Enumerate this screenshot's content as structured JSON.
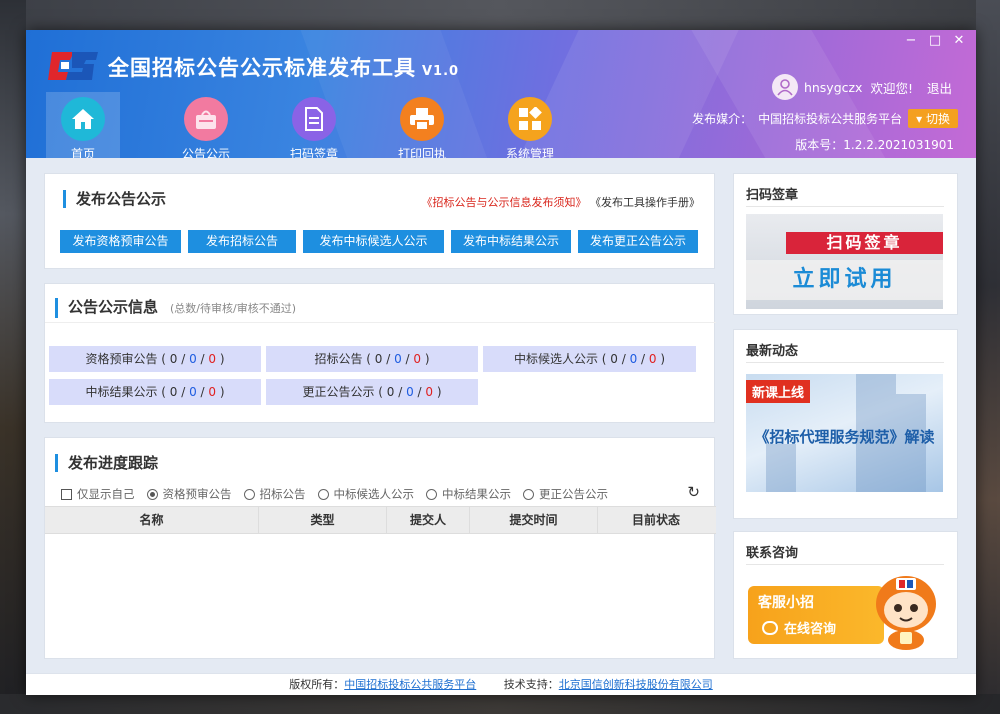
{
  "window": {
    "title": "全国招标公告公示标准发布工具",
    "version_badge": "V1.0",
    "minimize": "−",
    "maximize": "□",
    "close": "✕"
  },
  "nav": [
    {
      "label": "首页",
      "icon": "home-icon",
      "color": "#1fb8d8"
    },
    {
      "label": "公告公示",
      "icon": "bag-icon",
      "color": "#f27aa0"
    },
    {
      "label": "扫码签章",
      "icon": "document-icon",
      "color": "#8a63e6"
    },
    {
      "label": "打印回执",
      "icon": "printer-icon",
      "color": "#f3801f"
    },
    {
      "label": "系统管理",
      "icon": "grid-icon",
      "color": "#f5a31d"
    }
  ],
  "user": {
    "name": "hnsygczx",
    "welcome": "欢迎您!",
    "logout": "退出"
  },
  "media": {
    "label": "发布媒介：",
    "value": "中国招标投标公共服务平台",
    "switch": "▾ 切换"
  },
  "version": {
    "label": "版本号：",
    "value": "1.2.2.2021031901"
  },
  "publish": {
    "title": "发布公告公示",
    "link_notice": "《招标公告与公示信息发布须知》",
    "link_manual": "《发布工具操作手册》",
    "buttons": [
      "发布资格预审公告",
      "发布招标公告",
      "发布中标候选人公示",
      "发布中标结果公示",
      "发布更正公告公示"
    ]
  },
  "info": {
    "title": "公告公示信息",
    "hint": "(总数/待审核/审核不通过)",
    "stats": [
      {
        "label": "资格预审公告",
        "total": "0",
        "pending": "0",
        "rejected": "0"
      },
      {
        "label": "招标公告",
        "total": "0",
        "pending": "0",
        "rejected": "0"
      },
      {
        "label": "中标候选人公示",
        "total": "0",
        "pending": "0",
        "rejected": "0"
      },
      {
        "label": "中标结果公示",
        "total": "0",
        "pending": "0",
        "rejected": "0"
      },
      {
        "label": "更正公告公示",
        "total": "0",
        "pending": "0",
        "rejected": "0"
      }
    ]
  },
  "progress": {
    "title": "发布进度跟踪",
    "only_mine": "仅显示自己",
    "radios": [
      "资格预审公告",
      "招标公告",
      "中标候选人公示",
      "中标结果公示",
      "更正公告公示"
    ],
    "selected_radio": "资格预审公告",
    "columns": [
      "名称",
      "类型",
      "提交人",
      "提交时间",
      "目前状态"
    ],
    "refresh_icon": "refresh-icon"
  },
  "side": {
    "scan": {
      "title": "扫码签章",
      "banner_top": "扫码签章",
      "banner_mid": "立即试用"
    },
    "news": {
      "title": "最新动态",
      "tag": "新课上线",
      "text": "《招标代理服务规范》解读"
    },
    "contact": {
      "title": "联系咨询",
      "line1": "客服小招",
      "line2": "在线咨询"
    }
  },
  "footer": {
    "copyright_label": "版权所有：",
    "copyright_link": "中国招标投标公共服务平台",
    "support_label": "技术支持：",
    "support_link": "北京国信创新科技股份有限公司"
  },
  "colors": {
    "accent": "#1e8fe0",
    "stat_bg": "#d8dcfa",
    "pending": "#1e5ce0",
    "rejected": "#e02020",
    "link_red": "#d9261c"
  }
}
